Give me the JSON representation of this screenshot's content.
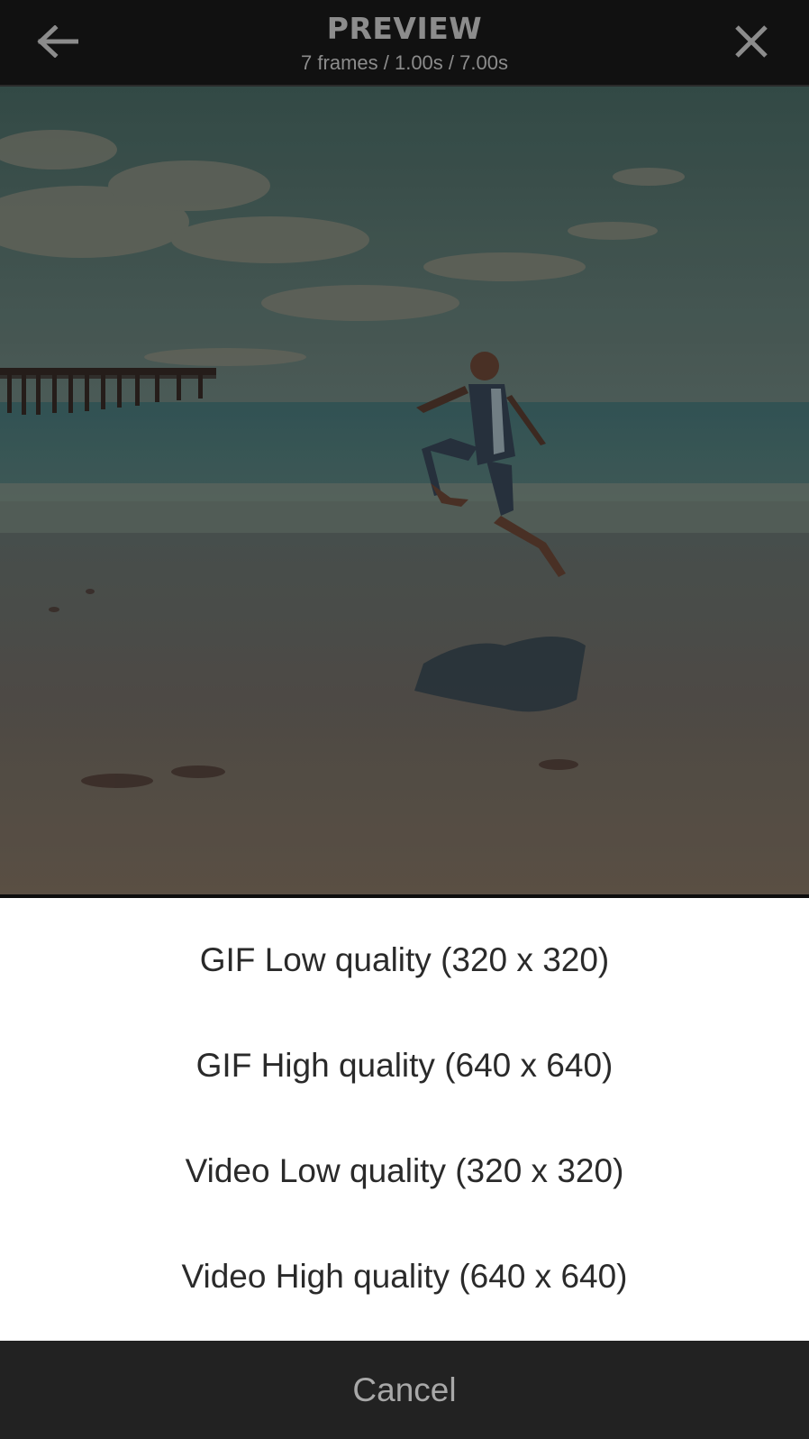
{
  "header": {
    "title": "PREVIEW",
    "subtitle": "7 frames / 1.00s / 7.00s",
    "back_icon": "arrow-left-icon",
    "close_icon": "close-icon"
  },
  "preview": {
    "description_icon": "photo"
  },
  "options": [
    {
      "label": "GIF Low quality (320 x 320)"
    },
    {
      "label": "GIF High quality (640 x 640)"
    },
    {
      "label": "Video Low quality (320 x 320)"
    },
    {
      "label": "Video High quality (640 x 640)"
    }
  ],
  "cancel": {
    "label": "Cancel"
  },
  "colors": {
    "header_bg": "#111111",
    "header_text": "#8c8c8c",
    "sheet_bg": "#ffffff",
    "option_text": "#2a2a2a",
    "cancel_bg": "#222222",
    "cancel_text": "#a8a8a8"
  }
}
